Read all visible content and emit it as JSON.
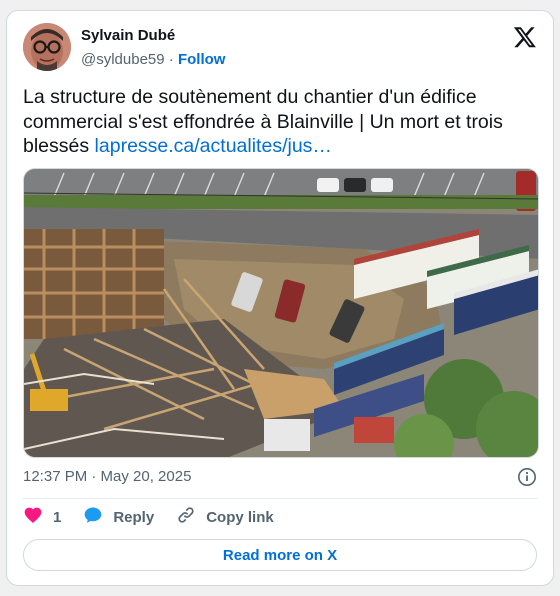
{
  "author": {
    "name": "Sylvain Dubé",
    "handle": "@syldube59",
    "separator": "·",
    "follow_label": "Follow"
  },
  "tweet": {
    "text": "La structure de soutènement du chantier d'un édifice commercial s'est effondrée à Blainville | Un mort et trois blessés ",
    "link_text": "lapresse.ca/actualites/jus…"
  },
  "meta": {
    "timestamp": "12:37 PM · May 20, 2025"
  },
  "actions": {
    "likes_count": "1",
    "reply_label": "Reply",
    "copy_link_label": "Copy link"
  },
  "read_more_label": "Read more on X",
  "colors": {
    "link": "#006fd6",
    "heart": "#f91880",
    "reply": "#1d9bf0",
    "text_secondary": "#536471",
    "border": "#cfd9de"
  },
  "icons": {
    "platform": "x-logo-icon",
    "info": "info-icon",
    "like": "heart-icon",
    "reply": "speech-bubble-icon",
    "copy": "link-icon"
  }
}
